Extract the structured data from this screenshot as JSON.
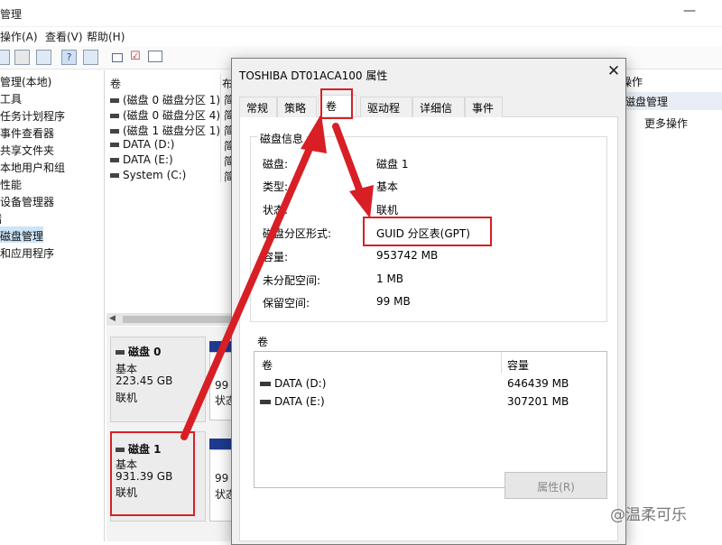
{
  "window": {
    "title": "管理",
    "minimize_glyph": "—"
  },
  "menu": [
    "操作(A)",
    "查看(V)",
    "帮助(H)"
  ],
  "toolbar": {
    "icons": [
      "back-icon",
      "forward-icon",
      "console-tree-icon",
      "properties-icon",
      "help-icon",
      "grid-icon",
      "refresh-icon",
      "check-icon",
      "list-icon"
    ]
  },
  "tree": {
    "items": [
      {
        "label": "管理(本地)"
      },
      {
        "label": "工具"
      },
      {
        "label": "任务计划程序"
      },
      {
        "label": "事件查看器"
      },
      {
        "label": "共享文件夹"
      },
      {
        "label": "本地用户和组"
      },
      {
        "label": "性能"
      },
      {
        "label": "设备管理器"
      },
      {
        "label": "储"
      },
      {
        "label": "磁盘管理",
        "selected": true
      },
      {
        "label": "和应用程序"
      }
    ]
  },
  "volume_list": {
    "header": "卷",
    "header_col2": "布",
    "rows": [
      "(磁盘 0 磁盘分区 1)",
      "(磁盘 0 磁盘分区 4)",
      "(磁盘 1 磁盘分区 1)",
      "DATA (D:)",
      "DATA (E:)",
      "System (C:)"
    ],
    "col2": [
      "简",
      "简",
      "简",
      "简",
      "简",
      "简"
    ]
  },
  "disks": [
    {
      "name": "磁盘 0",
      "type": "基本",
      "size": "223.45 GB",
      "status": "联机",
      "part_text_1": "99",
      "part_text_2": "状态"
    },
    {
      "name": "磁盘 1",
      "type": "基本",
      "size": "931.39 GB",
      "status": "联机",
      "part_text_1": "99",
      "part_text_2": "状态"
    }
  ],
  "actions": {
    "header": "操作",
    "selected": "磁盘管理",
    "more": "更多操作"
  },
  "dialog": {
    "title": "TOSHIBA DT01ACA100 属性",
    "tabs": [
      "常规",
      "策略",
      "卷",
      "驱动程序",
      "详细信息",
      "事件"
    ],
    "active_tab": "卷",
    "disk_group": "磁盘信息",
    "props": [
      {
        "label": "磁盘:",
        "value": "磁盘 1"
      },
      {
        "label": "类型:",
        "value": "基本"
      },
      {
        "label": "状态:",
        "value": "联机"
      },
      {
        "label": "磁盘分区形式:",
        "value": "GUID 分区表(GPT)"
      },
      {
        "label": "容量:",
        "value": "953742 MB"
      },
      {
        "label": "未分配空间:",
        "value": "1 MB"
      },
      {
        "label": "保留空间:",
        "value": "99 MB"
      }
    ],
    "vol_group": "卷",
    "vol_table": {
      "headers": [
        "卷",
        "容量"
      ],
      "rows": [
        {
          "name": "DATA (D:)",
          "cap": "646439 MB"
        },
        {
          "name": "DATA (E:)",
          "cap": "307201 MB"
        }
      ]
    },
    "properties_button": "属性(R)",
    "close_glyph": "✕"
  },
  "watermark": "@温柔可乐",
  "colors": {
    "annotation_red": "#d81f26",
    "selection_blue": "#cce4f7",
    "disk_strip": "#1f3a8f"
  }
}
